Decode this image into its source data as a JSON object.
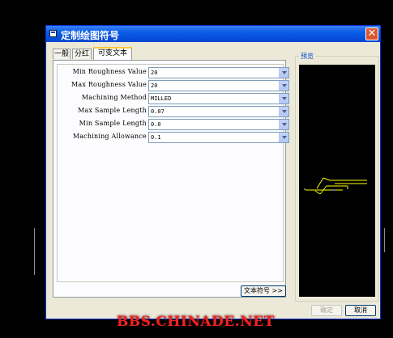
{
  "dialog": {
    "title": "定制绘图符号",
    "close_glyph": "✕",
    "tabs": [
      {
        "label": "一般"
      },
      {
        "label": "分红"
      },
      {
        "label": "可变文本"
      }
    ],
    "properties": [
      {
        "label": "Min Roughness Value",
        "value": "20"
      },
      {
        "label": "Max Roughness Value",
        "value": "20"
      },
      {
        "label": "Machining Method",
        "value": "MILLED"
      },
      {
        "label": "Max Sample Length",
        "value": "0.07"
      },
      {
        "label": "Min Sample Length",
        "value": "0.0"
      },
      {
        "label": "Machining Allowance",
        "value": "0.1"
      }
    ],
    "text_symbol_button": "文本符号 >>",
    "preview_label": "预览",
    "ok_button": "确定",
    "cancel_button": "取消"
  },
  "watermark": "BBS.CHINADE.NET",
  "colors": {
    "titlebar": "#0a5ce8",
    "dialog_bg": "#ece9d8",
    "symbol": "#ffff00",
    "watermark": "#e22222"
  }
}
